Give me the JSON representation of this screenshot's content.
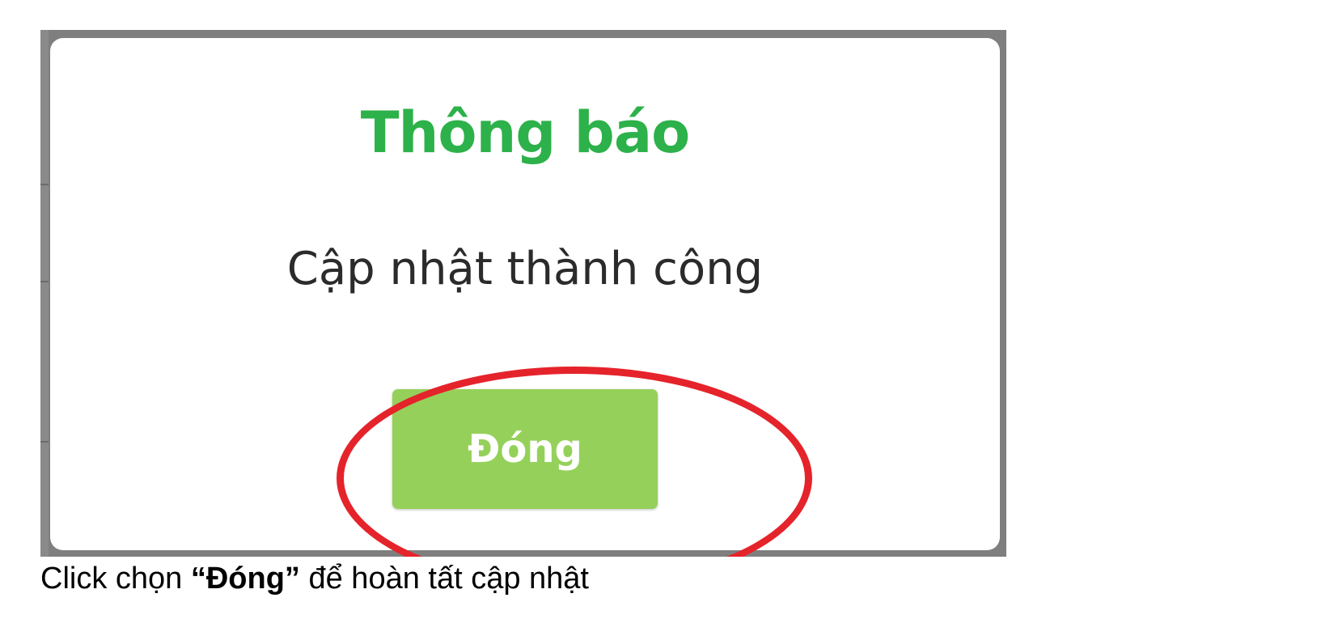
{
  "dialog": {
    "title": "Thông báo",
    "message": "Cập nhật thành công",
    "close_label": "Đóng"
  },
  "caption": {
    "prefix": "Click chọn ",
    "highlight": "“Đóng”",
    "suffix": " để hoàn tất cập nhật"
  },
  "colors": {
    "title": "#2db14a",
    "button": "#95d15a",
    "annotation": "#e5232b",
    "overlay": "#7f7f7f"
  }
}
